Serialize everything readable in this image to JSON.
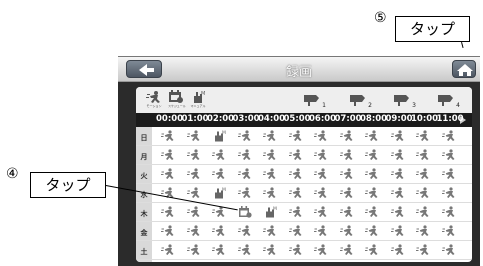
{
  "title": "録画",
  "callouts": [
    {
      "number": "⑤",
      "label": "タップ"
    },
    {
      "number": "④",
      "label": "タップ"
    }
  ],
  "mode_icons": [
    {
      "name": "motion-icon",
      "caption": "モーション"
    },
    {
      "name": "schedule-icon",
      "caption": "スケジュール"
    },
    {
      "name": "manual-icon",
      "caption": "マニュアル"
    }
  ],
  "cameras": [
    "1",
    "2",
    "3",
    "4"
  ],
  "hours": [
    "00:00",
    "01:00",
    "02:00",
    "03:00",
    "04:00",
    "05:00",
    "06:00",
    "07:00",
    "08:00",
    "09:00",
    "10:00",
    "11:00"
  ],
  "days": [
    "日",
    "月",
    "火",
    "水",
    "木",
    "金",
    "土"
  ],
  "schedule": [
    [
      "motion",
      "motion",
      "manual",
      "motion",
      "motion",
      "motion",
      "motion",
      "motion",
      "motion",
      "motion",
      "motion",
      "motion"
    ],
    [
      "motion",
      "motion",
      "motion",
      "motion",
      "motion",
      "motion",
      "motion",
      "motion",
      "motion",
      "motion",
      "motion",
      "motion"
    ],
    [
      "motion",
      "motion",
      "motion",
      "motion",
      "motion",
      "motion",
      "motion",
      "motion",
      "motion",
      "motion",
      "motion",
      "motion"
    ],
    [
      "motion",
      "motion",
      "manual",
      "motion",
      "motion",
      "motion",
      "motion",
      "motion",
      "motion",
      "motion",
      "motion",
      "motion"
    ],
    [
      "motion",
      "motion",
      "motion",
      "schedule",
      "manual",
      "motion",
      "motion",
      "motion",
      "motion",
      "motion",
      "motion",
      "motion"
    ],
    [
      "motion",
      "motion",
      "motion",
      "motion",
      "motion",
      "motion",
      "motion",
      "motion",
      "motion",
      "motion",
      "motion",
      "motion"
    ],
    [
      "motion",
      "motion",
      "motion",
      "motion",
      "motion",
      "motion",
      "motion",
      "motion",
      "motion",
      "motion",
      "motion",
      "motion"
    ]
  ]
}
